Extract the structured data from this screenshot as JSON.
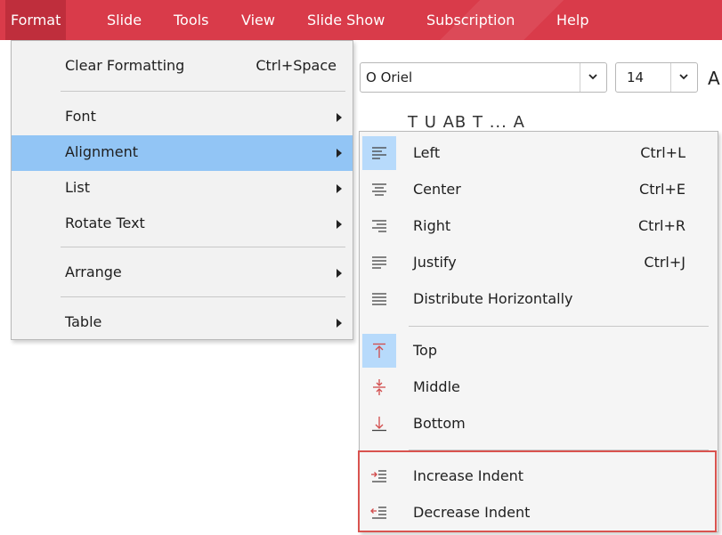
{
  "menubar": {
    "items": [
      {
        "label": "Format",
        "active": true
      },
      {
        "label": "Slide"
      },
      {
        "label": "Tools"
      },
      {
        "label": "View"
      },
      {
        "label": "Slide Show"
      },
      {
        "label": "Subscription"
      },
      {
        "label": "Help"
      }
    ]
  },
  "toolbar": {
    "font_value": "O Oriel",
    "size_value": "14",
    "partial_a": "A",
    "partial_tools": "T   U   AB   T   ...   A"
  },
  "format_menu": {
    "items": [
      {
        "label": "Clear Formatting",
        "shortcut": "Ctrl+Space"
      },
      {
        "label": "Font"
      },
      {
        "label": "Alignment"
      },
      {
        "label": "List"
      },
      {
        "label": "Rotate Text"
      },
      {
        "label": "Arrange"
      },
      {
        "label": "Table"
      }
    ]
  },
  "alignment_menu": {
    "items": [
      {
        "label": "Left",
        "shortcut": "Ctrl+L",
        "icon": "align-left-icon"
      },
      {
        "label": "Center",
        "shortcut": "Ctrl+E",
        "icon": "align-center-icon"
      },
      {
        "label": "Right",
        "shortcut": "Ctrl+R",
        "icon": "align-right-icon"
      },
      {
        "label": "Justify",
        "shortcut": "Ctrl+J",
        "icon": "justify-icon"
      },
      {
        "label": "Distribute Horizontally",
        "icon": "distribute-horizontally-icon"
      },
      {
        "label": "Top",
        "icon": "align-top-icon"
      },
      {
        "label": "Middle",
        "icon": "align-middle-icon"
      },
      {
        "label": "Bottom",
        "icon": "align-bottom-icon"
      },
      {
        "label": "Increase Indent",
        "icon": "increase-indent-icon"
      },
      {
        "label": "Decrease Indent",
        "icon": "decrease-indent-icon"
      }
    ]
  },
  "colors": {
    "menubar": "#d93b4a",
    "highlight": "#92c5f5",
    "icon_selected_bg": "#b7dafb",
    "annotation_box": "#d9534f"
  }
}
